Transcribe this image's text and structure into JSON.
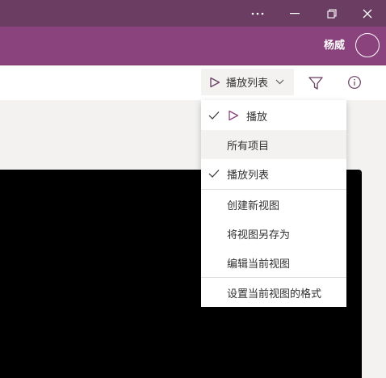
{
  "window": {
    "controls": {
      "more_icon": "ellipsis-icon",
      "minimize_icon": "minimize-icon",
      "restore_icon": "restore-icon",
      "close_icon": "close-icon"
    }
  },
  "appbar": {
    "user_name": "杨威"
  },
  "commandbar": {
    "view_selector_label": "播放列表",
    "filter_icon": "filter-icon",
    "info_icon": "info-icon"
  },
  "view_menu": {
    "items": [
      {
        "label": "播放",
        "checked": true,
        "icon": "play-icon"
      },
      {
        "label": "所有项目",
        "checked": false,
        "highlighted": true
      },
      {
        "label": "播放列表",
        "checked": true
      },
      {
        "label": "创建新视图",
        "checked": false
      },
      {
        "label": "将视图另存为",
        "checked": false
      },
      {
        "label": "编辑当前视图",
        "checked": false
      },
      {
        "label": "设置当前视图的格式",
        "checked": false
      }
    ]
  },
  "colors": {
    "titlebar": "#6b3d62",
    "appbar": "#8a437c",
    "accent": "#8a437c"
  }
}
